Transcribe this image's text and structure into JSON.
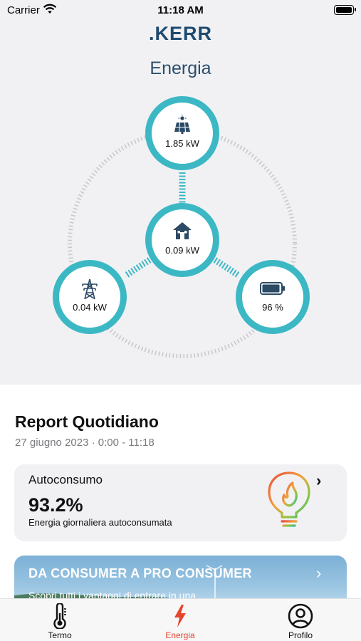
{
  "status_bar": {
    "carrier": "Carrier",
    "time": "11:18 AM"
  },
  "header": {
    "logo": "KERR",
    "logo_prefix": ".",
    "title": "Energia"
  },
  "energy_flow": {
    "solar": {
      "value": "1.85 kW",
      "icon": "solar-panel-icon"
    },
    "home": {
      "value": "0.09 kW",
      "icon": "house-icon"
    },
    "grid": {
      "value": "0.04 kW",
      "icon": "power-tower-icon"
    },
    "battery": {
      "value": "96 %",
      "icon": "battery-icon",
      "level": 0.96
    }
  },
  "report": {
    "title": "Report Quotidiano",
    "date": "27 giugno 2023 · 0:00 - 11:18"
  },
  "self_consumption_card": {
    "title": "Autoconsumo",
    "value": "93.2%",
    "subtitle": "Energia giornaliera autoconsumata",
    "icon": "lightbulb-flame-icon"
  },
  "promo_banner": {
    "title": "DA CONSUMER A PRO CONSUMER",
    "subtitle": "Scopri tutti i vantaggi di entrare in una"
  },
  "tab_bar": {
    "tabs": [
      {
        "label": "Termo",
        "icon": "thermometer-icon",
        "active": false
      },
      {
        "label": "Energia",
        "icon": "lightning-icon",
        "active": true
      },
      {
        "label": "Profilo",
        "icon": "profile-icon",
        "active": false
      }
    ]
  },
  "colors": {
    "accent_teal": "#3cb8c4",
    "brand_navy": "#1f4a6e",
    "active_tab": "#e5452f",
    "card_bg": "#f1f1f4"
  }
}
